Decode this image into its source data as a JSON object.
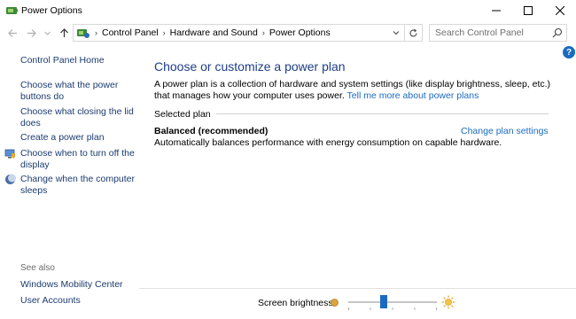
{
  "window": {
    "title": "Power Options",
    "icon": "power-options-icon"
  },
  "address": {
    "breadcrumbs": [
      "Control Panel",
      "Hardware and Sound",
      "Power Options"
    ]
  },
  "search": {
    "placeholder": "Search Control Panel"
  },
  "sidebar": {
    "home": "Control Panel Home",
    "items": [
      {
        "label": "Choose what the power buttons do",
        "icon": ""
      },
      {
        "label": "Choose what closing the lid does",
        "icon": ""
      },
      {
        "label": "Create a power plan",
        "icon": ""
      },
      {
        "label": "Choose when to turn off the display",
        "icon": "display-shield-icon"
      },
      {
        "label": "Change when the computer sleeps",
        "icon": "moon-icon"
      }
    ],
    "see_also_label": "See also",
    "see_also": [
      "Windows Mobility Center",
      "User Accounts"
    ]
  },
  "main": {
    "title": "Choose or customize a power plan",
    "description": "A power plan is a collection of hardware and system settings (like display brightness, sleep, etc.) that manages how your computer uses power.",
    "learn_more": "Tell me more about power plans",
    "selected_plan_label": "Selected plan",
    "plan_name": "Balanced (recommended)",
    "plan_description": "Automatically balances performance with energy consumption on capable hardware.",
    "change_plan": "Change plan settings"
  },
  "brightness": {
    "label": "Screen brightness:",
    "value_fraction": 0.4
  },
  "colors": {
    "accent": "#1a6bc0",
    "title": "#1e3d87",
    "link": "#1b3b6f"
  }
}
